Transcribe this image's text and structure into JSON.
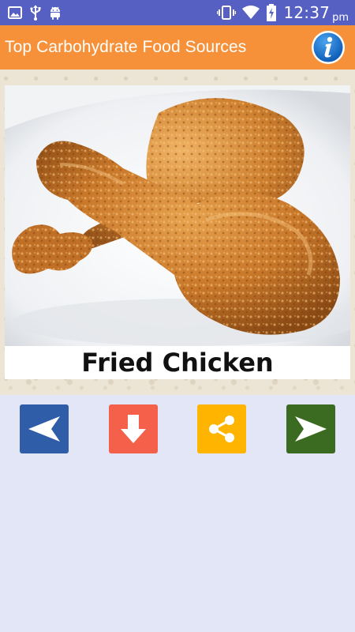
{
  "status_bar": {
    "time": "12:37",
    "ampm": "pm",
    "icons": [
      "image-icon",
      "usb-icon",
      "android-icon",
      "vibrate-icon",
      "wifi-icon",
      "battery-charging-icon"
    ]
  },
  "app_bar": {
    "title": "Top Carbohydrate Food Sources",
    "info_icon": "info-icon"
  },
  "food": {
    "name": "Fried Chicken"
  },
  "controls": {
    "previous_icon": "arrow-left-icon",
    "download_icon": "arrow-down-icon",
    "share_icon": "share-icon",
    "next_icon": "arrow-right-icon"
  },
  "colors": {
    "status_bar": "#5660c2",
    "app_bar": "#f6913a",
    "background": "#e3e6f7",
    "previous_button": "#2f5da8",
    "download_button": "#f4604a",
    "share_button": "#ffb400",
    "next_button": "#3b6b21"
  }
}
